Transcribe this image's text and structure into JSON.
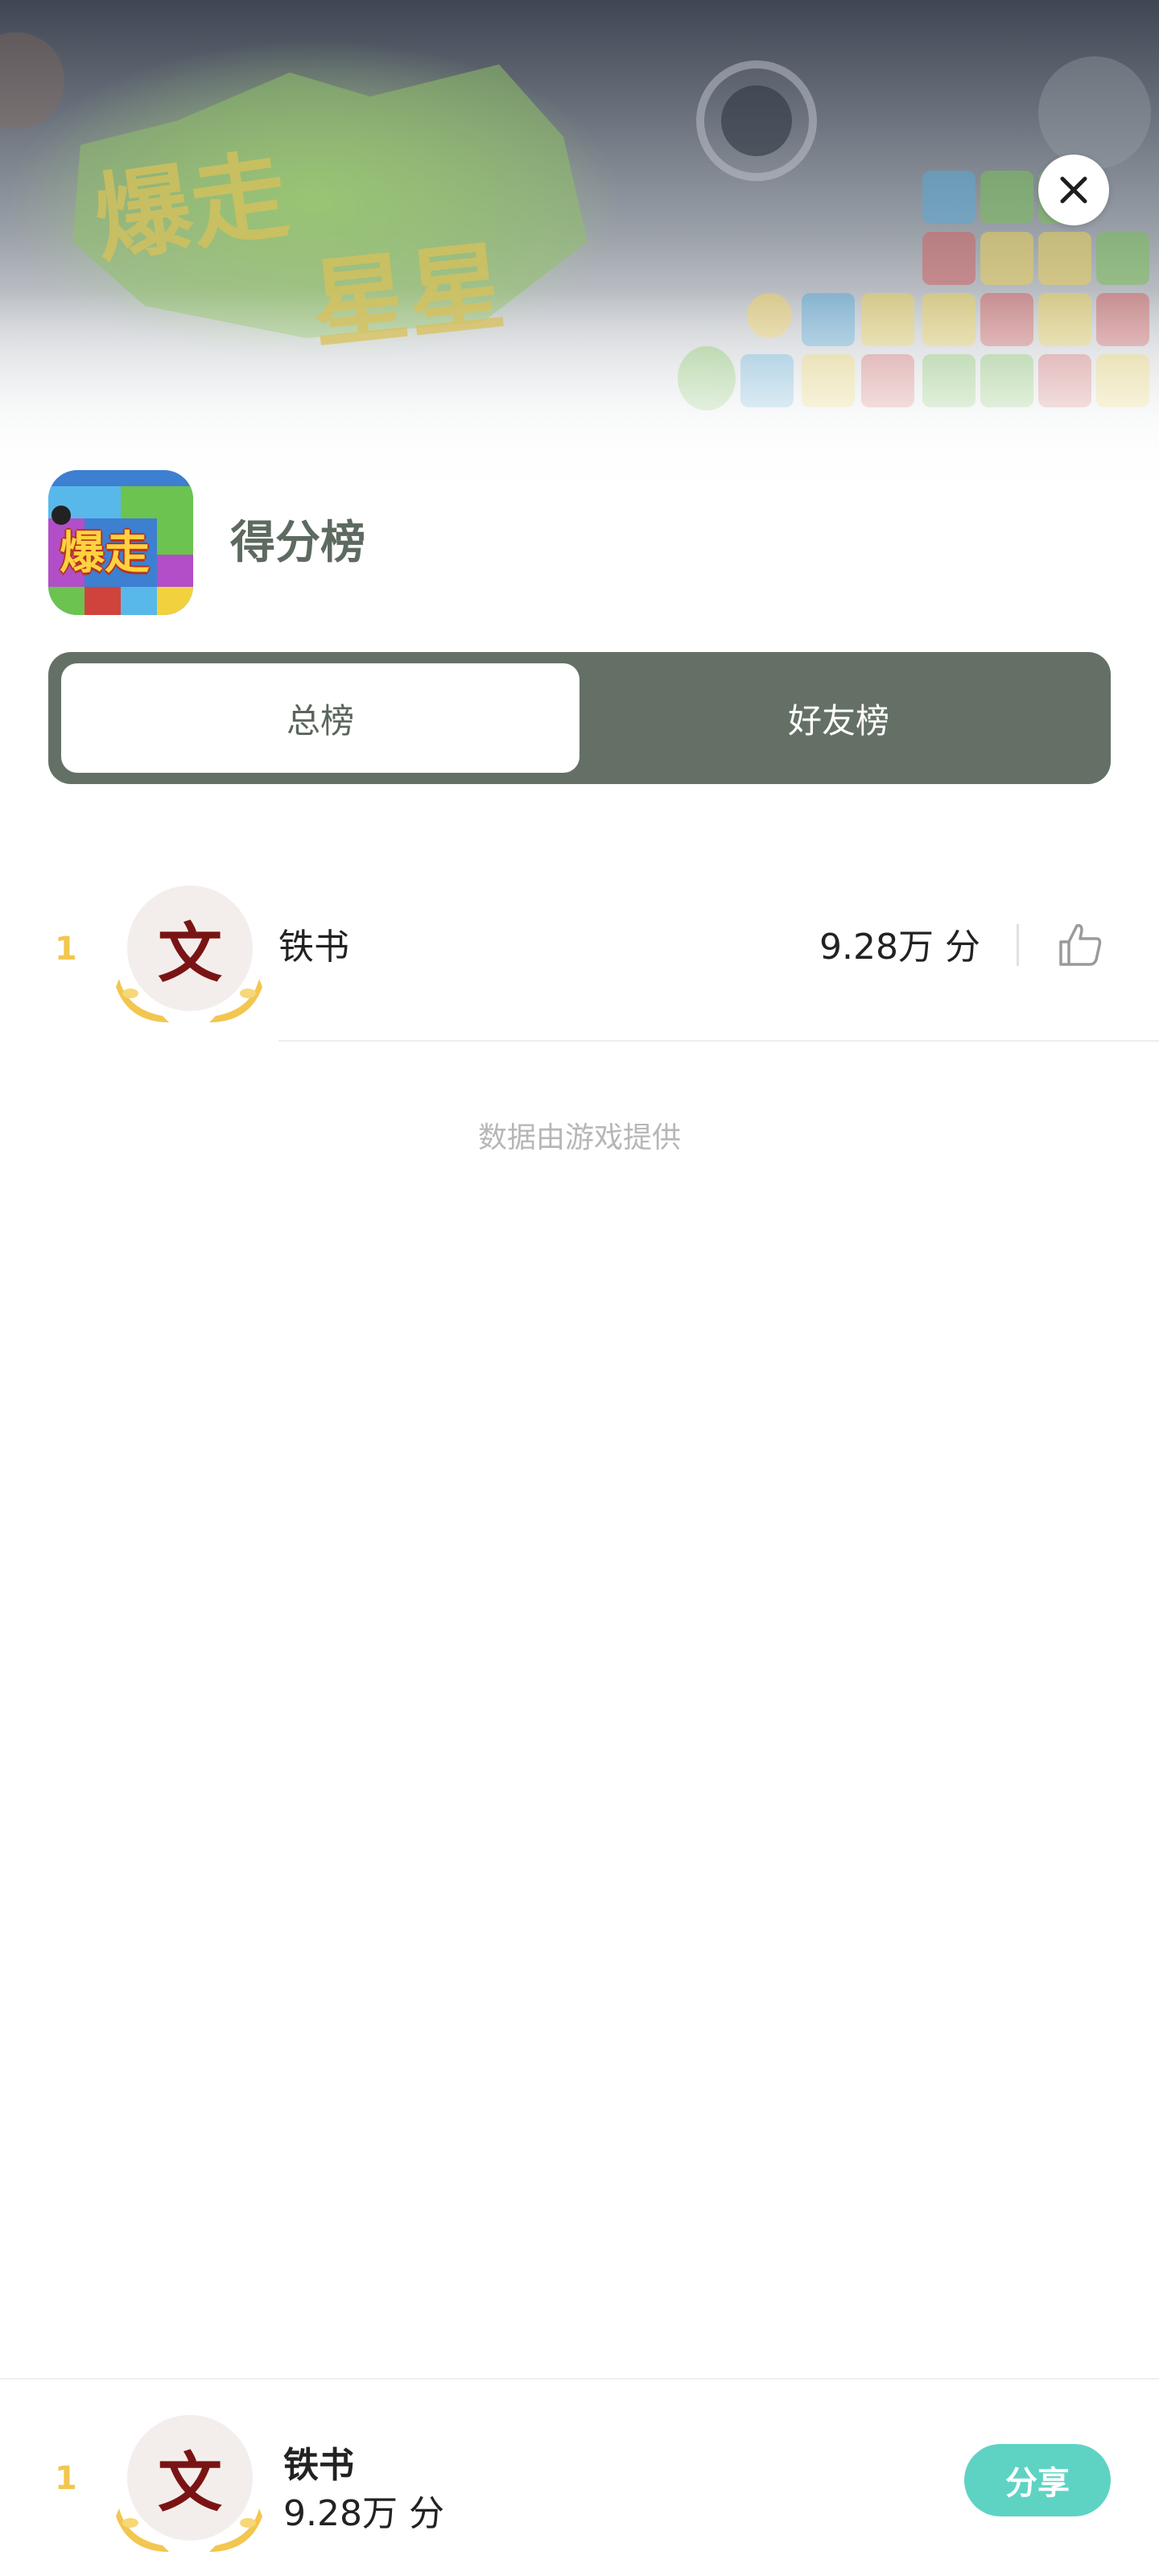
{
  "banner": {
    "game_logo_text": [
      "爆走",
      "星星"
    ]
  },
  "header": {
    "app_icon_text": "爆走",
    "title": "得分榜"
  },
  "tabs": [
    {
      "label": "总榜",
      "active": true
    },
    {
      "label": "好友榜",
      "active": false
    }
  ],
  "leaderboard": {
    "rows": [
      {
        "rank": "1",
        "name": "铁书",
        "score": "9.28万 分",
        "avatar_char": "文"
      }
    ]
  },
  "footnote": "数据由游戏提供",
  "my_rank": {
    "rank": "1",
    "name": "铁书",
    "score": "9.28万 分",
    "avatar_char": "文",
    "share_label": "分享"
  },
  "colors": {
    "accent": "#647066",
    "rank_gold": "#f2c64f",
    "share": "#5ed3c4",
    "title": "#5d6a60"
  }
}
